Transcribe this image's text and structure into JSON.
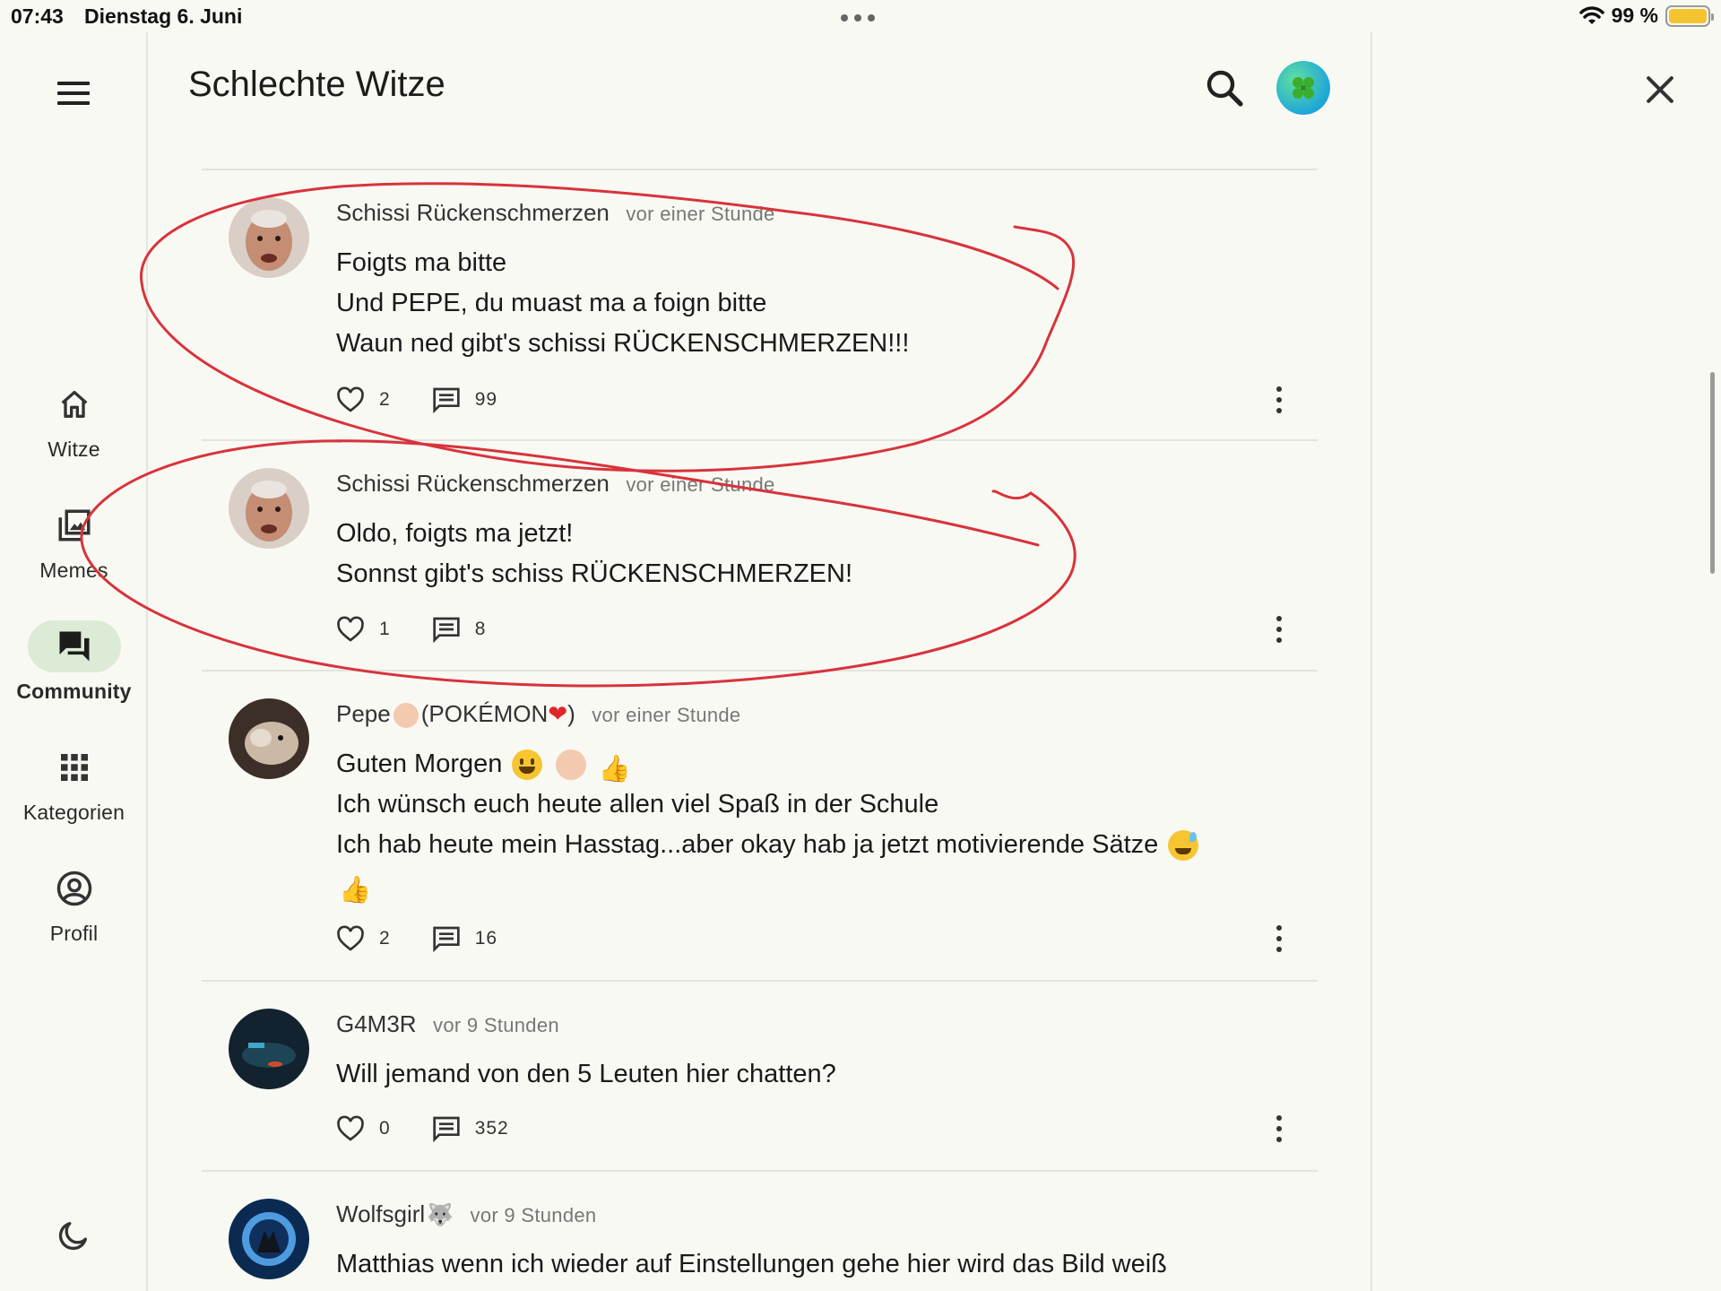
{
  "status": {
    "time": "07:43",
    "date": "Dienstag 6. Juni",
    "battery": "99 %"
  },
  "nav": {
    "items": [
      {
        "label": "Witze",
        "icon": "home-icon",
        "active": false
      },
      {
        "label": "Memes",
        "icon": "gallery-icon",
        "active": false
      },
      {
        "label": "Community",
        "icon": "forum-icon",
        "active": true
      },
      {
        "label": "Kategorien",
        "icon": "grid-icon",
        "active": false
      },
      {
        "label": "Profil",
        "icon": "account-circle-icon",
        "active": false
      }
    ],
    "theme_icon": "moon-icon"
  },
  "header": {
    "title": "Schlechte Witze",
    "avatar_icon": "clover-icon"
  },
  "posts": [
    {
      "author": "Schissi Rückenschmerzen",
      "time": "vor einer Stunde",
      "lines": [
        "Foigts ma bitte",
        "Und PEPE, du muast ma a foign bitte",
        "Waun ned gibt's schissi RÜCKENSCHMERZEN!!!"
      ],
      "likes": "2",
      "comments": "99"
    },
    {
      "author": "Schissi Rückenschmerzen",
      "time": "vor einer Stunde",
      "lines": [
        "Oldo, foigts ma jetzt!",
        "Sonnst gibt's schiss RÜCKENSCHMERZEN!"
      ],
      "likes": "1",
      "comments": "8"
    },
    {
      "author_prefix": "Pepe",
      "author_mid": "(POKÉMON",
      "author_suffix": ")",
      "time": "vor einer Stunde",
      "line1": "Guten Morgen",
      "line2": "Ich wünsch euch heute allen viel Spaß in der Schule",
      "line3": "Ich hab heute mein Hasstag...aber okay hab ja jetzt motivierende Sätze",
      "likes": "2",
      "comments": "16"
    },
    {
      "author": "G4M3R",
      "time": "vor 9 Stunden",
      "lines": [
        "Will jemand von den 5 Leuten hier chatten?"
      ],
      "likes": "0",
      "comments": "352"
    },
    {
      "author": "Wolfsgirl",
      "time": "vor 9 Stunden",
      "lines": [
        "Matthias wenn ich wieder auf Einstellungen gehe hier wird das Bild weiß"
      ]
    }
  ],
  "colors": {
    "accent_bg": "#dcebd6",
    "annotation": "#d8333b",
    "background": "#f9f9f4"
  }
}
